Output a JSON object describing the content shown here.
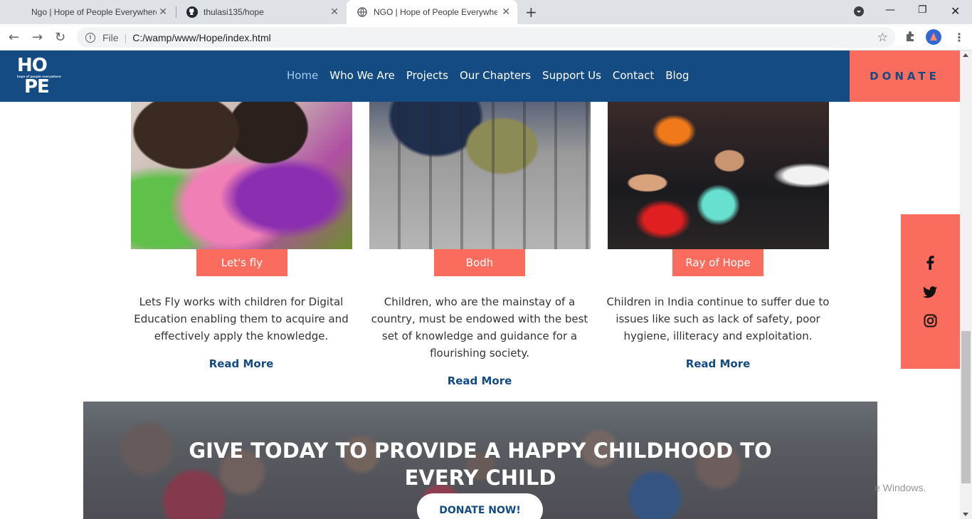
{
  "browser": {
    "tabs": [
      {
        "title": "Ngo | Hope of People Everywhere"
      },
      {
        "title": "thulasi135/hope"
      },
      {
        "title": "NGO | Hope of People Everywhere"
      }
    ],
    "address": {
      "file_label": "File",
      "url": "C:/wamp/www/Hope/index.html"
    }
  },
  "site": {
    "logo": {
      "line1": "HO",
      "tagline": "hope of people everywhere",
      "line2": "PE"
    },
    "nav": [
      {
        "label": "Home"
      },
      {
        "label": "Who We Are"
      },
      {
        "label": "Projects"
      },
      {
        "label": "Our Chapters"
      },
      {
        "label": "Support Us"
      },
      {
        "label": "Contact"
      },
      {
        "label": "Blog"
      }
    ],
    "donate_label": "DONATE"
  },
  "projects": [
    {
      "label": "Let's fly",
      "text": "Lets Fly works with children for Digital Education enabling them to acquire and effectively apply the knowledge.",
      "link": "Read More"
    },
    {
      "label": "Bodh",
      "text": "Children, who are the mainstay of a country, must be endowed with the best set of knowledge and guidance for a flourishing society.",
      "link": "Read More"
    },
    {
      "label": "Ray of Hope",
      "text": "Children in India continue to suffer due to issues like such as lack of safety, poor hygiene, illiteracy and exploitation.",
      "link": "Read More"
    }
  ],
  "banner": {
    "title": "GIVE TODAY TO PROVIDE A HAPPY CHILDHOOD TO EVERY CHILD",
    "button": "DONATE NOW!"
  },
  "watermark": "e Windows.",
  "colors": {
    "primary": "#134b82",
    "accent": "#fa6c5d"
  },
  "social_icons": [
    "facebook-icon",
    "twitter-icon",
    "instagram-icon"
  ]
}
